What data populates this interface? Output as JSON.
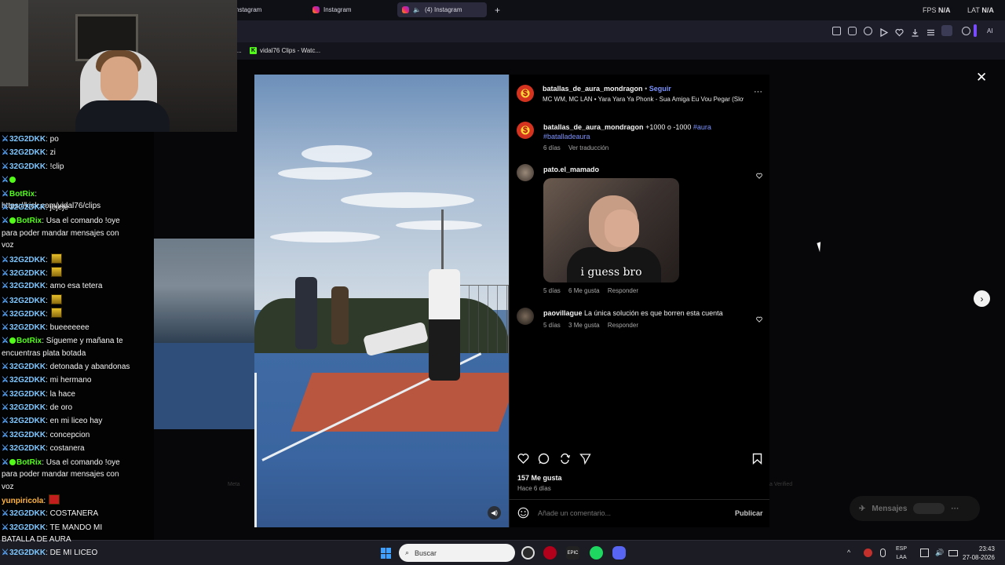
{
  "browser": {
    "tabs": [
      {
        "label": "nstagram"
      },
      {
        "label": "Instagram"
      },
      {
        "label": "(4) Instagram"
      }
    ],
    "bookmark_prefix": "...",
    "bookmark": "vidal76 Clips - Watc...",
    "ai_label": "AI"
  },
  "hud": {
    "fps_label": "FPS",
    "fps_value": "N/A",
    "lat_label": "LAT",
    "lat_value": "N/A"
  },
  "chat": {
    "messages": [
      {
        "user": "32G2DKK",
        "text": "po",
        "color": "#7ec8ff",
        "lines": 1
      },
      {
        "user": "32G2DKK",
        "text": "zi",
        "color": "#7ec8ff",
        "lines": 1
      },
      {
        "user": "32G2DKK",
        "text": "!clip",
        "color": "#7ec8ff",
        "lines": 1
      },
      {
        "user": "",
        "text": "",
        "color": "#53fc18",
        "lines": 1,
        "badge_only": true
      },
      {
        "user": "BotRix",
        "text": "https://kick.com/vidal76/clips",
        "color": "#53fc18",
        "lines": 1
      },
      {
        "user": "32G2DKK",
        "text": "jejeje",
        "color": "#7ec8ff",
        "lines": 1
      },
      {
        "user": "BotRix",
        "text": "Usa el comando !oye para poder mandar mensajes con voz",
        "color": "#53fc18",
        "lines": 3,
        "verified": true
      },
      {
        "user": "32G2DKK",
        "text": "",
        "color": "#7ec8ff",
        "lines": 1,
        "emote": true
      },
      {
        "user": "32G2DKK",
        "text": "",
        "color": "#7ec8ff",
        "lines": 1,
        "emote": true
      },
      {
        "user": "32G2DKK",
        "text": "amo esa tetera",
        "color": "#7ec8ff",
        "lines": 1
      },
      {
        "user": "32G2DKK",
        "text": "",
        "color": "#7ec8ff",
        "lines": 1,
        "emote": true
      },
      {
        "user": "32G2DKK",
        "text": "",
        "color": "#7ec8ff",
        "lines": 1,
        "emote": true
      },
      {
        "user": "32G2DKK",
        "text": "bueeeeeee",
        "color": "#7ec8ff",
        "lines": 1
      },
      {
        "user": "BotRix",
        "text": "Sígueme y mañana te encuentras plata botada",
        "color": "#53fc18",
        "lines": 2,
        "verified": true
      },
      {
        "user": "32G2DKK",
        "text": "detonada y abandonas",
        "color": "#7ec8ff",
        "lines": 1
      },
      {
        "user": "32G2DKK",
        "text": "mi hermano",
        "color": "#7ec8ff",
        "lines": 1
      },
      {
        "user": "32G2DKK",
        "text": "la hace",
        "color": "#7ec8ff",
        "lines": 1
      },
      {
        "user": "32G2DKK",
        "text": "de oro",
        "color": "#7ec8ff",
        "lines": 1
      },
      {
        "user": "32G2DKK",
        "text": "en mi liceo hay",
        "color": "#7ec8ff",
        "lines": 1
      },
      {
        "user": "32G2DKK",
        "text": "concepcion",
        "color": "#7ec8ff",
        "lines": 1
      },
      {
        "user": "32G2DKK",
        "text": "costanera",
        "color": "#7ec8ff",
        "lines": 1
      },
      {
        "user": "BotRix",
        "text": "Usa el comando !oye para poder mandar mensajes con voz",
        "color": "#53fc18",
        "lines": 3,
        "verified": true
      },
      {
        "user": "yunpiricola",
        "text": "",
        "color": "#ffb43c",
        "lines": 1,
        "emote_red": true,
        "no_badge": true
      },
      {
        "user": "32G2DKK",
        "text": "COSTANERA",
        "color": "#7ec8ff",
        "lines": 1
      },
      {
        "user": "32G2DKK",
        "text": "TE MANDO MI BATALLA DE AURA",
        "color": "#7ec8ff",
        "lines": 2
      },
      {
        "user": "32G2DKK",
        "text": "DE MI LICEO",
        "color": "#7ec8ff",
        "lines": 1
      }
    ]
  },
  "post": {
    "author": "batallas_de_aura_mondragon",
    "dot": "•",
    "follow_label": "Seguir",
    "audio": "MC WM, MC LAN • Yara Yara Ya Phonk - Sua Amiga Eu Vou Pegar (Slowe",
    "caption_user": "batallas_de_aura_mondragon",
    "caption_text": "+1000 o -1000",
    "hashtag1": "#aura",
    "hashtag2": "#batalladeaura",
    "caption_age": "6 días",
    "translate_label": "Ver traducción",
    "likes": "157 Me gusta",
    "age": "Hace 6 días",
    "comment_placeholder": "Añade un comentario...",
    "publish_label": "Publicar"
  },
  "comments": [
    {
      "user": "pato.el_mamado",
      "gif_caption": "i guess bro",
      "age": "5 días",
      "likes": "6 Me gusta",
      "reply_label": "Responder"
    },
    {
      "user": "paovillague",
      "text": "La única solución es que borren esta cuenta",
      "age": "5 días",
      "likes": "3 Me gusta",
      "reply_label": "Responder"
    }
  ],
  "page": {
    "footer_left": "Meta",
    "footer_right": "a Verified",
    "messages_label": "Mensajes"
  },
  "taskbar": {
    "search_placeholder": "Buscar",
    "lang1": "ESP",
    "lang2": "LAA",
    "time": "23:43",
    "date": "27-08-2026"
  }
}
